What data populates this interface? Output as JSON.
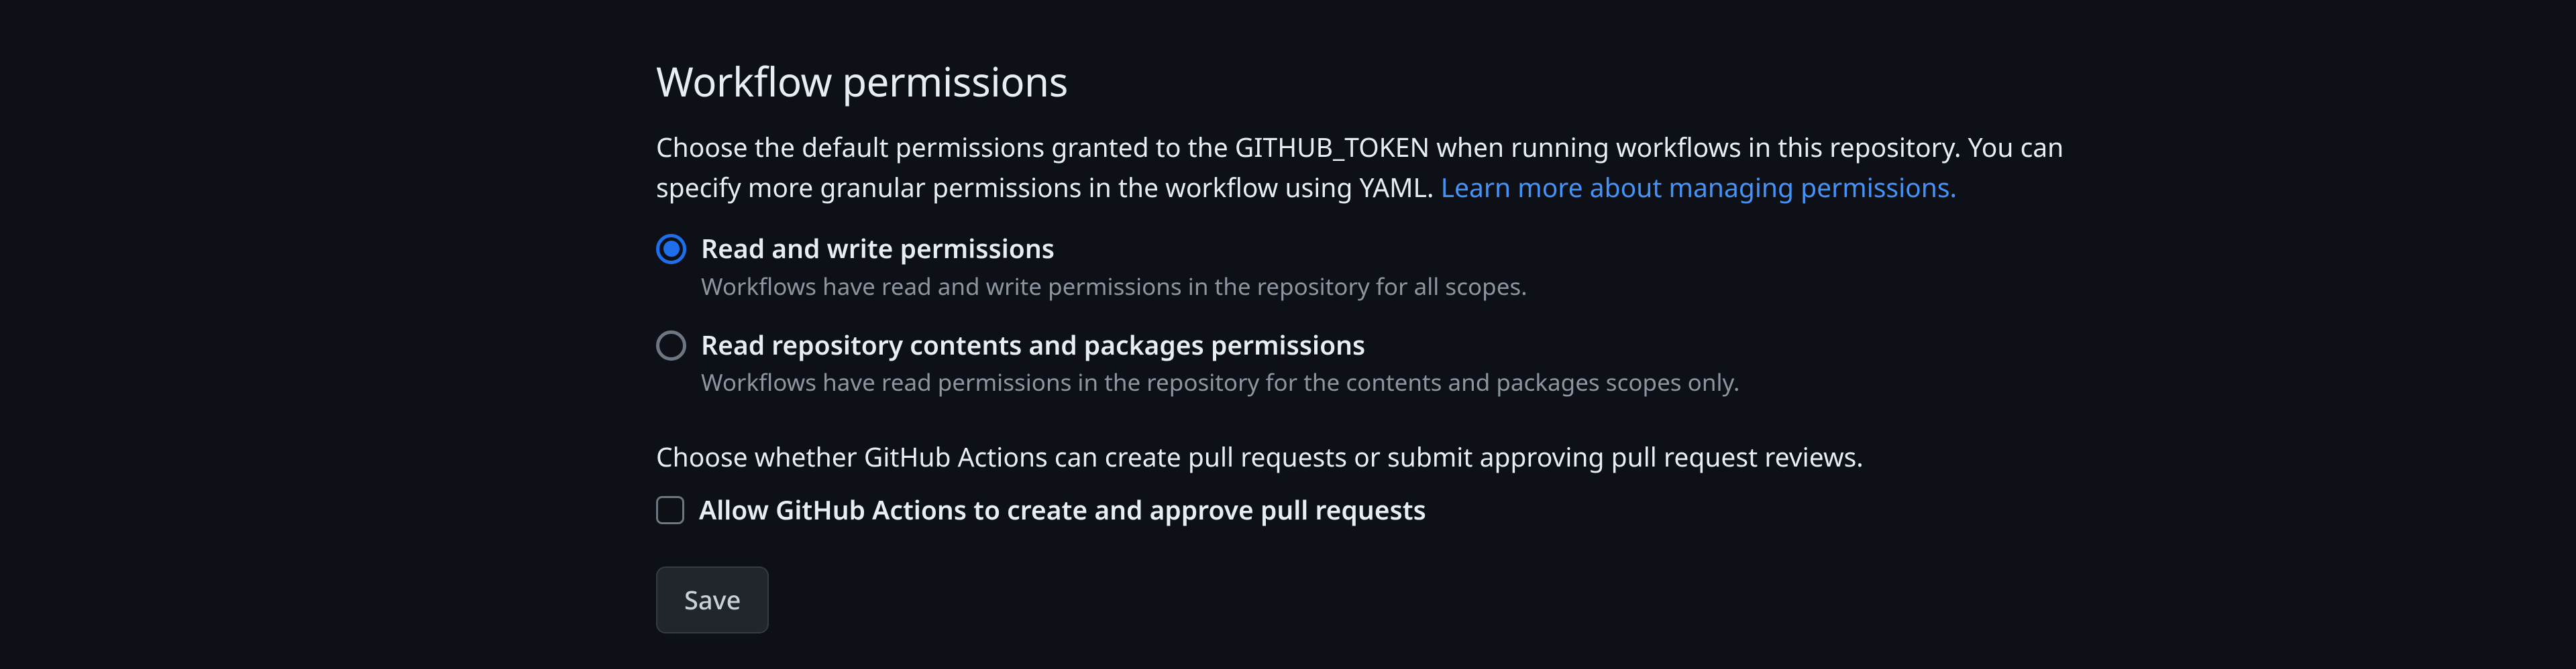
{
  "heading": "Workflow permissions",
  "intro": {
    "text": "Choose the default permissions granted to the GITHUB_TOKEN when running workflows in this repository. You can specify more granular permissions in the workflow using YAML. ",
    "link": "Learn more about managing permissions."
  },
  "options": [
    {
      "title": "Read and write permissions",
      "desc": "Workflows have read and write permissions in the repository for all scopes.",
      "checked": true
    },
    {
      "title": "Read repository contents and packages permissions",
      "desc": "Workflows have read permissions in the repository for the contents and packages scopes only.",
      "checked": false
    }
  ],
  "checkbox": {
    "intro": "Choose whether GitHub Actions can create pull requests or submit approving pull request reviews.",
    "label": "Allow GitHub Actions to create and approve pull requests",
    "checked": false
  },
  "save_label": "Save"
}
